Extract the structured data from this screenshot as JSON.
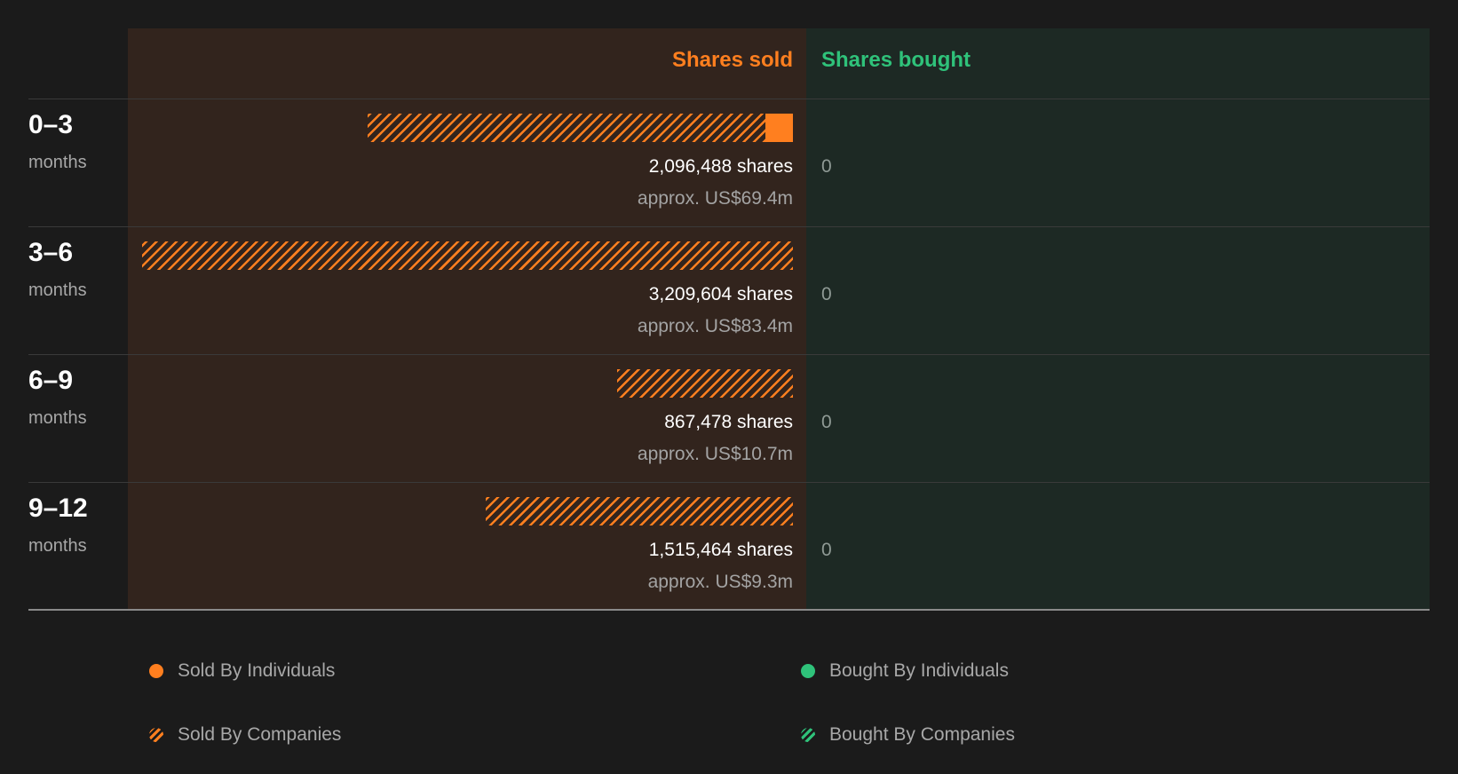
{
  "colors": {
    "sold": "#ff7f1f",
    "bought": "#2fc27a",
    "sold_bg": "#32241d",
    "bought_bg": "#1d2924",
    "page_bg": "#1b1b1b"
  },
  "chart_data": {
    "type": "bar",
    "headers": {
      "sold": "Shares sold",
      "bought": "Shares bought"
    },
    "period_unit": "months",
    "rows": [
      {
        "period": "0–3",
        "sold_by_companies": 1960000,
        "sold_by_individuals": 136488,
        "shares_label": "2,096,488 shares",
        "approx_label": "approx. US$69.4m",
        "bought_label": "0"
      },
      {
        "period": "3–6",
        "sold_by_companies": 3209604,
        "sold_by_individuals": 0,
        "shares_label": "3,209,604 shares",
        "approx_label": "approx. US$83.4m",
        "bought_label": "0"
      },
      {
        "period": "6–9",
        "sold_by_companies": 867478,
        "sold_by_individuals": 0,
        "shares_label": "867,478 shares",
        "approx_label": "approx. US$10.7m",
        "bought_label": "0"
      },
      {
        "period": "9–12",
        "sold_by_companies": 1515464,
        "sold_by_individuals": 0,
        "shares_label": "1,515,464 shares",
        "approx_label": "approx. US$9.3m",
        "bought_label": "0"
      }
    ],
    "max_value": 3209604,
    "legend": [
      {
        "label": "Sold By Individuals",
        "swatch": "sold-solid"
      },
      {
        "label": "Bought By Individuals",
        "swatch": "bought-solid"
      },
      {
        "label": "Sold By Companies",
        "swatch": "sold-hatch"
      },
      {
        "label": "Bought By Companies",
        "swatch": "bought-hatch"
      }
    ]
  }
}
